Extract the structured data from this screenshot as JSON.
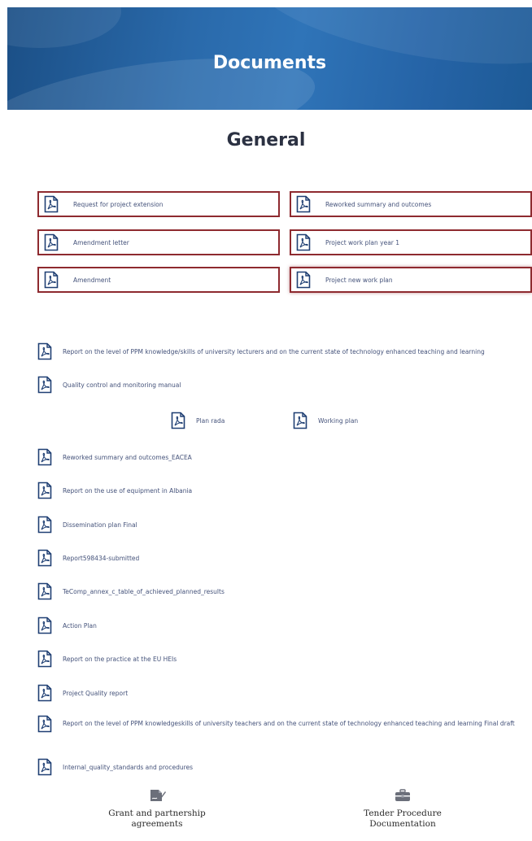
{
  "banner": {
    "title": "Documents"
  },
  "section": {
    "title": "General"
  },
  "boxed_docs": [
    "Request for project extension",
    "Reworked summary and outcomes",
    "Amendment letter",
    "Project work plan year 1",
    "Amendment",
    "Project new work plan"
  ],
  "docs": {
    "report_ppm_lecturers": "Report on the level of PPM knowledge/skills of university lecturers and on the current state of technology enhanced teaching and learning",
    "quality_manual": "Quality control and monitoring manual",
    "plan_rada": "Plan rada",
    "working_plan": "Working plan",
    "reworked_eacea": "Reworked summary and outcomes_EACEA",
    "equipment_albania": "Report on the use of equipment in Albania",
    "dissemination": "Dissemination plan Final",
    "report_submitted": "Report598434-submitted",
    "tecomp_annex": "TeComp_annex_c_table_of_achieved_planned_results",
    "action_plan": "Action Plan",
    "practice_eu": "Report on the practice at the EU HEIs",
    "quality_report": "Project Quality report",
    "report_final_draft": "Report on the level of PPM knowledgeskills of university teachers and on the current state of technology enhanced teaching and learning Final draft",
    "internal_standards": "Internal_quality_standards and procedures"
  },
  "categories": {
    "grant_line1": "Grant and partnership",
    "grant_line2": "agreements",
    "tender_line1": "Tender Procedure",
    "tender_line2": "Documentation"
  },
  "icons": {
    "document": "pdf-file-icon",
    "grant": "signed-document-icon",
    "tender": "briefcase-icon"
  },
  "colors": {
    "banner": "#2a6aab",
    "box_border": "#8e2a2f",
    "text": "#44527a"
  }
}
